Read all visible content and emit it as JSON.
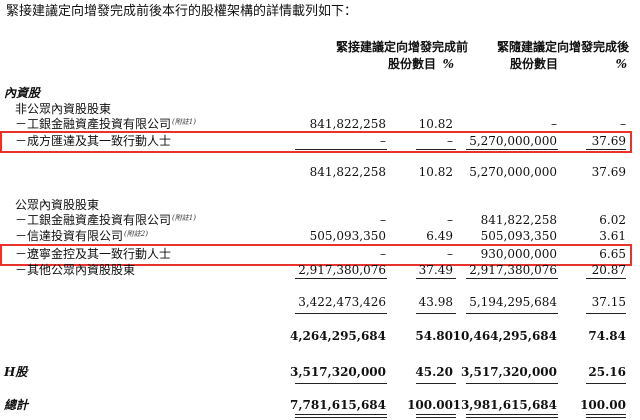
{
  "intro": "緊接建議定向增發完成前後本行的股權架構的詳情載列如下：",
  "headers": {
    "before_title": "緊接建議定向增發完成前",
    "after_title": "緊隨建議定向增發完成後",
    "shares_label": "股份數目",
    "pct_label": "%"
  },
  "sections": {
    "domestic": "內資股",
    "non_public": "非公眾內資股股東",
    "public": "公眾內資股股東",
    "h_shares": "H股",
    "total": "總計"
  },
  "rows": {
    "icbc_np": {
      "name": "－工銀金融資產投資有限公司",
      "note": "(附註1)",
      "before_shares": "841,822,258",
      "before_pct": "10.82",
      "after_shares": "–",
      "after_pct": "–"
    },
    "chengfang": {
      "name": "－成方匯達及其一致行動人士",
      "before_shares": "–",
      "before_pct": "–",
      "after_shares": "5,270,000,000",
      "after_pct": "37.69"
    },
    "sub1": {
      "before_shares": "841,822,258",
      "before_pct": "10.82",
      "after_shares": "5,270,000,000",
      "after_pct": "37.69"
    },
    "icbc_p": {
      "name": "－工銀金融資產投資有限公司",
      "note": "(附註1)",
      "before_shares": "–",
      "before_pct": "–",
      "after_shares": "841,822,258",
      "after_pct": "6.02"
    },
    "xinda": {
      "name": "－信達投資有限公司",
      "note": "(附註2)",
      "before_shares": "505,093,350",
      "before_pct": "6.49",
      "after_shares": "505,093,350",
      "after_pct": "3.61"
    },
    "liaoning": {
      "name": "－遼寧金控及其一致行動人士",
      "before_shares": "–",
      "before_pct": "–",
      "after_shares": "930,000,000",
      "after_pct": "6.65"
    },
    "other": {
      "name": "－其他公眾內資股股東",
      "before_shares": "2,917,380,076",
      "before_pct": "37.49",
      "after_shares": "2,917,380,076",
      "after_pct": "20.87"
    },
    "sub2": {
      "before_shares": "3,422,473,426",
      "before_pct": "43.98",
      "after_shares": "5,194,295,684",
      "after_pct": "37.15"
    },
    "domestic_total": {
      "before_shares": "4,264,295,684",
      "before_pct": "54.80",
      "after_shares": "10,464,295,684",
      "after_pct": "74.84"
    },
    "h": {
      "before_shares": "3,517,320,000",
      "before_pct": "45.20",
      "after_shares": "3,517,320,000",
      "after_pct": "25.16"
    },
    "grand": {
      "before_shares": "7,781,615,684",
      "before_pct": "100.00",
      "after_shares": "13,981,615,684",
      "after_pct": "100.00"
    }
  },
  "colors": {
    "highlight": "#e8322b"
  }
}
